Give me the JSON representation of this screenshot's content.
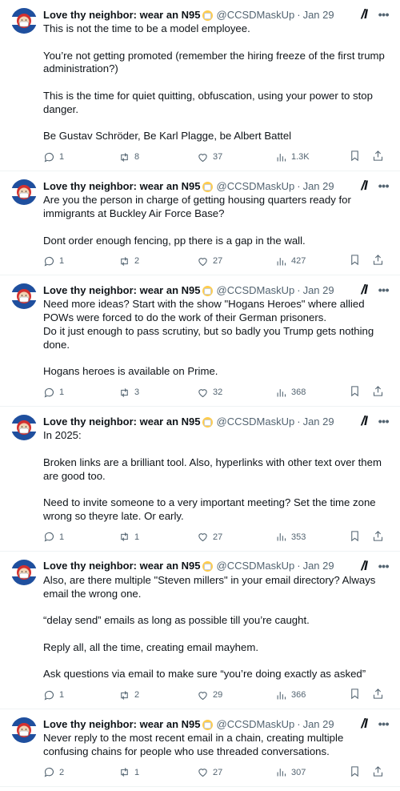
{
  "author": {
    "name": "Love thy neighbor: wear an N95",
    "handle": "@CCSDMaskUp",
    "separator": "·"
  },
  "icons": {
    "grok": "Grok-icon",
    "more": "more-icon",
    "reply": "reply-icon",
    "retweet": "retweet-icon",
    "like": "heart-icon",
    "views": "views-icon",
    "bookmark": "bookmark-icon",
    "share": "share-icon"
  },
  "colors": {
    "text": "#0f1419",
    "muted": "#536471",
    "divider": "#eff3f4"
  },
  "tweets": [
    {
      "date": "Jan 29",
      "body": [
        "This is not the time to be a model employee.",
        "",
        "You’re not getting promoted (remember the hiring freeze of the first trump administration?)",
        "",
        "This is the time for quiet quitting, obfuscation, using your power to stop danger.",
        "",
        "Be Gustav Schröder, Be Karl Plagge, be Albert Battel"
      ],
      "replies": "1",
      "retweets": "8",
      "likes": "37",
      "views": "1.3K"
    },
    {
      "date": "Jan 29",
      "body": [
        "Are you the person in charge of getting housing quarters ready for immigrants at Buckley Air Force Base?",
        "",
        "Dont order enough fencing, pp there is a gap in the wall."
      ],
      "replies": "1",
      "retweets": "2",
      "likes": "27",
      "views": "427"
    },
    {
      "date": "Jan 29",
      "body": [
        "Need more ideas?  Start with the show \"Hogans Heroes\" where allied POWs were forced to do the work of their German prisoners.",
        "Do it just enough to pass scrutiny, but so badly you Trump gets nothing done.",
        "",
        "Hogans heroes is available on Prime."
      ],
      "replies": "1",
      "retweets": "3",
      "likes": "32",
      "views": "368"
    },
    {
      "date": "Jan 29",
      "body": [
        "In 2025:",
        "",
        "Broken links are a brilliant tool. Also, hyperlinks with other text over them are good too.",
        "",
        "Need to invite someone to a very important meeting? Set the time zone wrong so theyre late. Or early."
      ],
      "replies": "1",
      "retweets": "1",
      "likes": "27",
      "views": "353"
    },
    {
      "date": "Jan 29",
      "body": [
        "Also, are there multiple \"Steven millers\" in your email  directory?  Always email the wrong one.",
        "",
        "“delay send” emails as long as possible till you’re caught.",
        "",
        "Reply all, all the time, creating email mayhem.",
        "",
        "Ask questions via email to make sure “you’re doing exactly as asked”"
      ],
      "replies": "1",
      "retweets": "2",
      "likes": "29",
      "views": "366"
    },
    {
      "date": "Jan 29",
      "body": [
        "Never reply to the most recent email in a chain, creating multiple confusing chains for people who use threaded conversations."
      ],
      "replies": "2",
      "retweets": "1",
      "likes": "27",
      "views": "307"
    }
  ]
}
